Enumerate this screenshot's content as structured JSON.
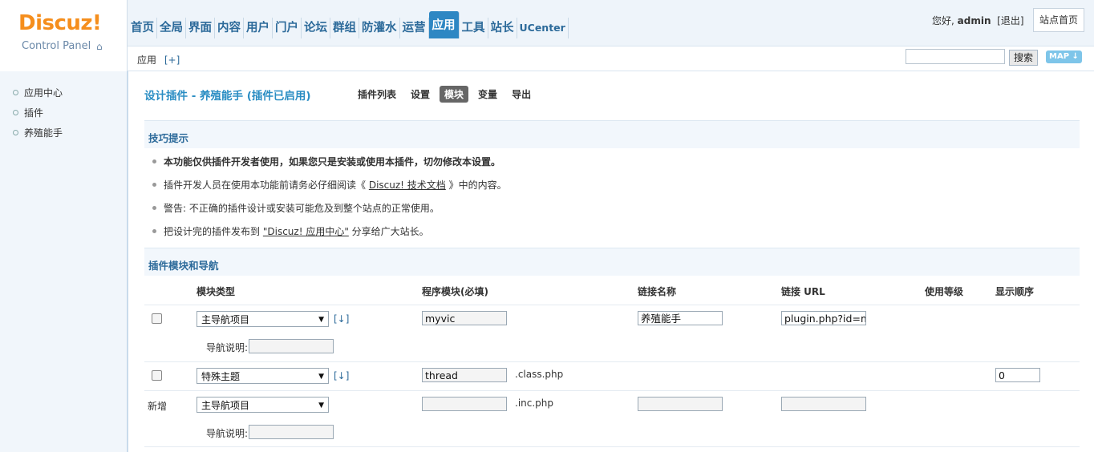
{
  "logo": {
    "main": "Discuz!",
    "sub": "Control Panel",
    "home_glyph": "⌂"
  },
  "topnav": [
    "首页",
    "全局",
    "界面",
    "内容",
    "用户",
    "门户",
    "论坛",
    "群组",
    "防灌水",
    "运营",
    "应用",
    "工具",
    "站长",
    "UCenter"
  ],
  "topnav_active": "应用",
  "header": {
    "greeting": "您好,",
    "user": "admin",
    "logout": "[退出]",
    "site_home": "站点首页"
  },
  "subbar": {
    "crumb": "应用",
    "plus": "[+]",
    "search_btn": "搜索",
    "map_btn": "MAP ↓"
  },
  "sidebar": [
    "应用中心",
    "插件",
    "养殖能手"
  ],
  "main": {
    "title": "设计插件 - 养殖能手 (插件已启用)",
    "tabs": [
      "插件列表",
      "设置",
      "模块",
      "变量",
      "导出"
    ],
    "active_tab": "模块",
    "tips_heading": "技巧提示",
    "tips": {
      "t1": "本功能仅供插件开发者使用，如果您只是安装或使用本插件，切勿修改本设置。",
      "t2_pre": "插件开发人员在使用本功能前请务必仔细阅读《",
      "t2_link": "Discuz! 技术文档",
      "t2_post": "》中的内容。",
      "t3": "警告: 不正确的插件设计或安装可能危及到整个站点的正常使用。",
      "t4_pre": "把设计完的插件发布到",
      "t4_link": "\"Discuz! 应用中心\"",
      "t4_post": "分享给广大站长。"
    },
    "modules_heading": "插件模块和导航",
    "columns": [
      "模块类型",
      "程序模块(必填)",
      "链接名称",
      "链接 URL",
      "使用等级",
      "显示顺序"
    ],
    "rows": [
      {
        "type": "主导航项目",
        "updown": "[↓]",
        "module": "myvic",
        "link_name": "养殖能手",
        "link_url": "plugin.php?id=m",
        "nav_desc_label": "导航说明:",
        "nav_desc": ""
      },
      {
        "type": "特殊主题",
        "updown": "[↓]",
        "module": "thread",
        "suffix": ".class.php",
        "order": "0"
      },
      {
        "label": "新增",
        "type": "主导航项目",
        "module": "",
        "suffix": ".inc.php",
        "link_name": "",
        "link_url": "",
        "nav_desc_label": "导航说明:",
        "nav_desc": ""
      }
    ]
  }
}
